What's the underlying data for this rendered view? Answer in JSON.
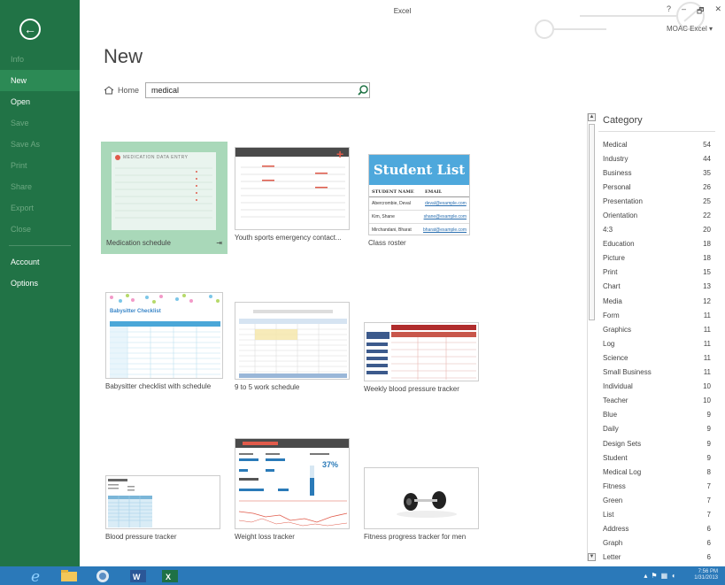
{
  "window": {
    "title": "Excel",
    "account": "MOAC Excel",
    "controls": [
      "?",
      "–",
      "🗗",
      "✕"
    ]
  },
  "sidebar": {
    "items": [
      {
        "label": "Info",
        "state": "dim"
      },
      {
        "label": "New",
        "state": "active"
      },
      {
        "label": "Open",
        "state": "bright"
      },
      {
        "label": "Save",
        "state": "dim"
      },
      {
        "label": "Save As",
        "state": "dim"
      },
      {
        "label": "Print",
        "state": "dim"
      },
      {
        "label": "Share",
        "state": "dim"
      },
      {
        "label": "Export",
        "state": "dim"
      },
      {
        "label": "Close",
        "state": "dim"
      }
    ],
    "bottom_items": [
      {
        "label": "Account"
      },
      {
        "label": "Options"
      }
    ]
  },
  "main": {
    "title": "New",
    "breadcrumb_home": "Home",
    "search_value": "medical"
  },
  "templates": [
    {
      "label": "Medication schedule",
      "header": "MEDICATION DATA ENTRY"
    },
    {
      "label": "Youth sports emergency contact..."
    },
    {
      "label": "Class roster",
      "header": "Student List",
      "cols": [
        "STUDENT NAME",
        "EMAIL"
      ],
      "rows": [
        [
          "Abercrombie, Deval",
          "deval@example.com"
        ],
        [
          "Kim, Shane",
          "shane@example.com"
        ],
        [
          "Mirchandani, Bharat",
          "bharat@example.com"
        ]
      ]
    },
    {
      "label": "Babysitter checklist with schedule",
      "header": "Babysitter Checklist"
    },
    {
      "label": "9 to 5 work schedule"
    },
    {
      "label": "Weekly blood pressure tracker"
    },
    {
      "label": "Blood pressure tracker"
    },
    {
      "label": "Weight loss tracker",
      "stat": "37%"
    },
    {
      "label": "Fitness progress tracker for men"
    }
  ],
  "category": {
    "title": "Category",
    "items": [
      {
        "name": "Medical",
        "count": "54"
      },
      {
        "name": "Industry",
        "count": "44"
      },
      {
        "name": "Business",
        "count": "35"
      },
      {
        "name": "Personal",
        "count": "26"
      },
      {
        "name": "Presentation",
        "count": "25"
      },
      {
        "name": "Orientation",
        "count": "22"
      },
      {
        "name": "4:3",
        "count": "20"
      },
      {
        "name": "Education",
        "count": "18"
      },
      {
        "name": "Picture",
        "count": "18"
      },
      {
        "name": "Print",
        "count": "15"
      },
      {
        "name": "Chart",
        "count": "13"
      },
      {
        "name": "Media",
        "count": "12"
      },
      {
        "name": "Form",
        "count": "11"
      },
      {
        "name": "Graphics",
        "count": "11"
      },
      {
        "name": "Log",
        "count": "11"
      },
      {
        "name": "Science",
        "count": "11"
      },
      {
        "name": "Small Business",
        "count": "11"
      },
      {
        "name": "Individual",
        "count": "10"
      },
      {
        "name": "Teacher",
        "count": "10"
      },
      {
        "name": "Blue",
        "count": "9"
      },
      {
        "name": "Daily",
        "count": "9"
      },
      {
        "name": "Design Sets",
        "count": "9"
      },
      {
        "name": "Student",
        "count": "9"
      },
      {
        "name": "Medical Log",
        "count": "8"
      },
      {
        "name": "Fitness",
        "count": "7"
      },
      {
        "name": "Green",
        "count": "7"
      },
      {
        "name": "List",
        "count": "7"
      },
      {
        "name": "Address",
        "count": "6"
      },
      {
        "name": "Graph",
        "count": "6"
      },
      {
        "name": "Letter",
        "count": "6"
      }
    ]
  },
  "taskbar": {
    "time": "7:56 PM",
    "date": "1/31/2013"
  },
  "colors": {
    "excel_green": "#217346",
    "active_nav": "#2c8a55",
    "selected_tile": "#a9d8b9",
    "taskbar_blue": "#2b79b9"
  }
}
